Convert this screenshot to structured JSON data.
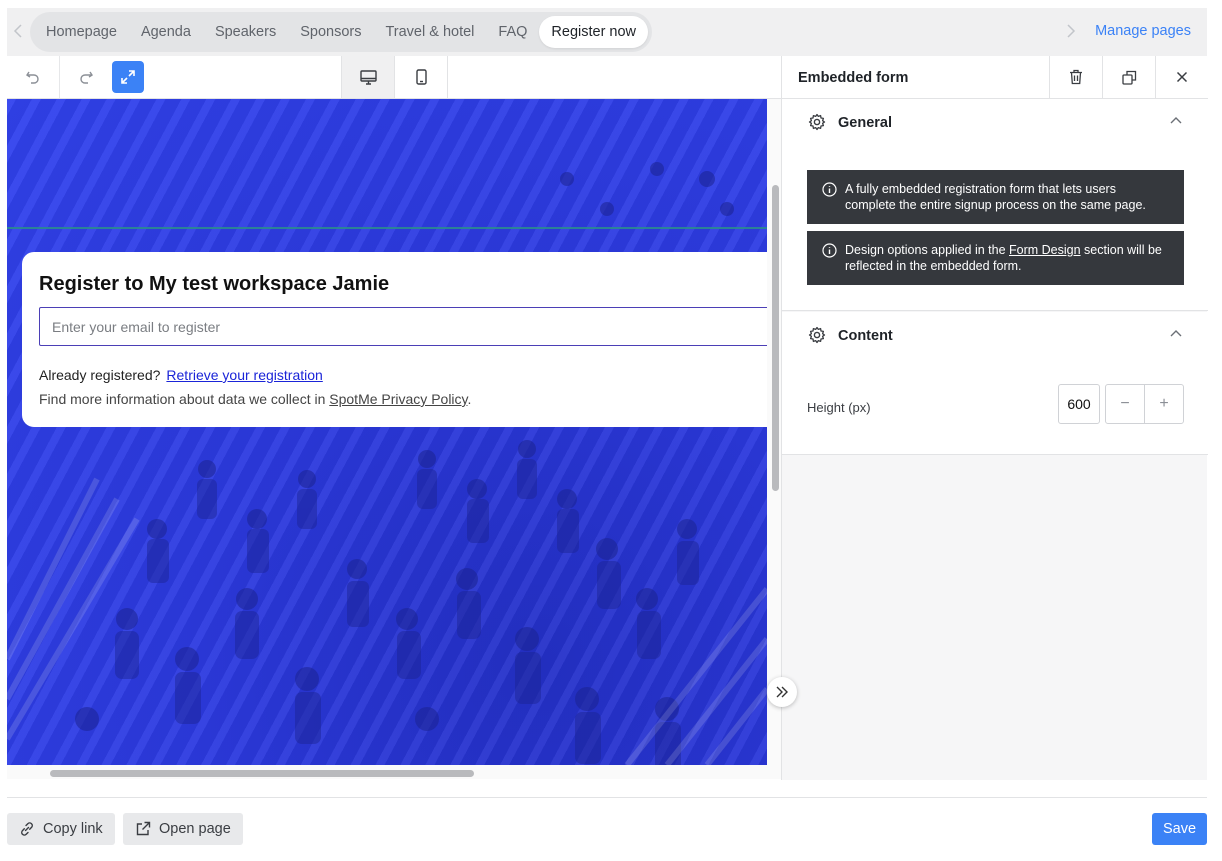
{
  "page_tabs": {
    "items": [
      {
        "label": "Homepage"
      },
      {
        "label": "Agenda"
      },
      {
        "label": "Speakers"
      },
      {
        "label": "Sponsors"
      },
      {
        "label": "Travel & hotel"
      },
      {
        "label": "FAQ"
      },
      {
        "label": "Register now",
        "active": true
      }
    ],
    "manage_label": "Manage pages"
  },
  "toolbar": {
    "icons": [
      "undo-icon",
      "redo-icon",
      "fit-screen-icon",
      "desktop-icon",
      "mobile-icon"
    ]
  },
  "canvas": {
    "form_title": "Register to My test workspace Jamie",
    "email_placeholder": "Enter your email to register",
    "already_text": "Already registered?",
    "retrieve_link": "Retrieve your registration",
    "privacy_prefix": "Find more information about data we collect in ",
    "privacy_link": "SpotMe Privacy Policy",
    "privacy_suffix": "."
  },
  "panel": {
    "title": "Embedded form",
    "general": {
      "title": "General",
      "info1": "A fully embedded registration form that lets users complete the entire signup process on the same page.",
      "info2_prefix": "Design options applied in the ",
      "info2_link": "Form Design",
      "info2_suffix": " section will be reflected in the embedded form."
    },
    "content": {
      "title": "Content",
      "height_label": "Height (px)",
      "height_value": "600",
      "minus": "−",
      "plus": "+"
    }
  },
  "footer": {
    "copy_link": "Copy link",
    "open_page": "Open page",
    "save": "Save"
  },
  "colors": {
    "accent": "#3b82f6",
    "hero_blue": "#2c3ae0",
    "info_bg": "#35383d"
  }
}
